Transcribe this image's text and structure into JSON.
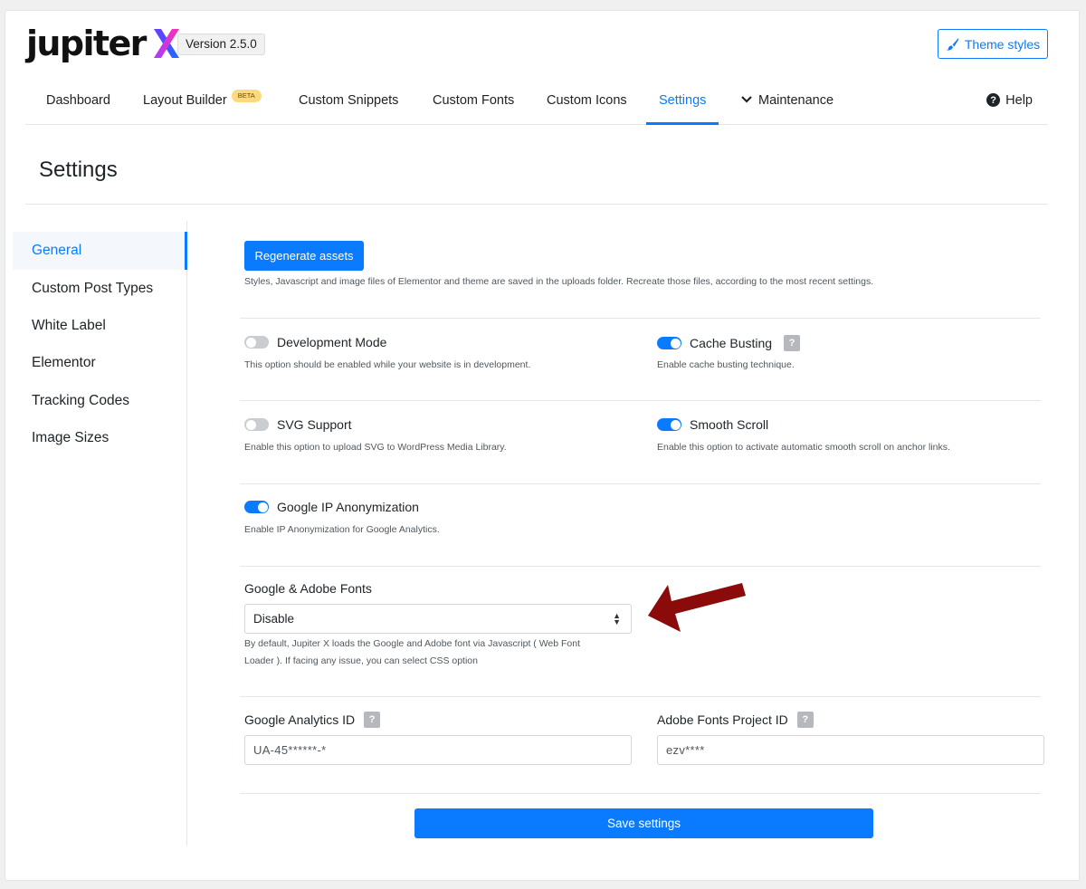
{
  "header": {
    "logo_word": "jupiter",
    "version": "Version 2.5.0",
    "theme_styles_label": "Theme styles"
  },
  "nav": {
    "items": [
      {
        "label": "Dashboard"
      },
      {
        "label": "Layout Builder",
        "badge": "BETA"
      },
      {
        "label": "Custom Snippets"
      },
      {
        "label": "Custom Fonts"
      },
      {
        "label": "Custom Icons"
      },
      {
        "label": "Settings",
        "active": true
      },
      {
        "label": "Maintenance"
      }
    ],
    "help_label": "Help"
  },
  "page": {
    "title": "Settings"
  },
  "sidebar": {
    "items": [
      {
        "label": "General",
        "active": true
      },
      {
        "label": "Custom Post Types"
      },
      {
        "label": "White Label"
      },
      {
        "label": "Elementor"
      },
      {
        "label": "Tracking Codes"
      },
      {
        "label": "Image Sizes"
      }
    ]
  },
  "general": {
    "regenerate_label": "Regenerate assets",
    "regenerate_desc": "Styles, Javascript and image files of Elementor and theme are saved in the uploads folder. Recreate those files, according to the most recent settings.",
    "dev_mode": {
      "label": "Development Mode",
      "desc": "This option should be enabled while your website is in development.",
      "on": false
    },
    "cache_busting": {
      "label": "Cache Busting",
      "desc": "Enable cache busting technique.",
      "on": true
    },
    "svg_support": {
      "label": "SVG Support",
      "desc": "Enable this option to upload SVG to WordPress Media Library.",
      "on": false
    },
    "smooth_scroll": {
      "label": "Smooth Scroll",
      "desc": "Enable this option to activate automatic smooth scroll on anchor links.",
      "on": true
    },
    "ip_anon": {
      "label": "Google IP Anonymization",
      "desc": "Enable IP Anonymization for Google Analytics.",
      "on": true
    },
    "fonts": {
      "label": "Google & Adobe Fonts",
      "selected": "Disable",
      "desc_line1": "By default, Jupiter X loads the Google and Adobe font via Javascript ( Web Font",
      "desc_line2": "Loader ). If facing any issue, you can select CSS option"
    },
    "analytics": {
      "label": "Google Analytics ID",
      "value": "UA-45******-*"
    },
    "adobe_project": {
      "label": "Adobe Fonts Project ID",
      "value": "ezv****"
    },
    "save_label": "Save settings",
    "help_mark": "?"
  },
  "colors": {
    "accent": "#0a7bff",
    "annotation_arrow": "#8b0a0a",
    "beta_badge": "#fcd97e"
  }
}
